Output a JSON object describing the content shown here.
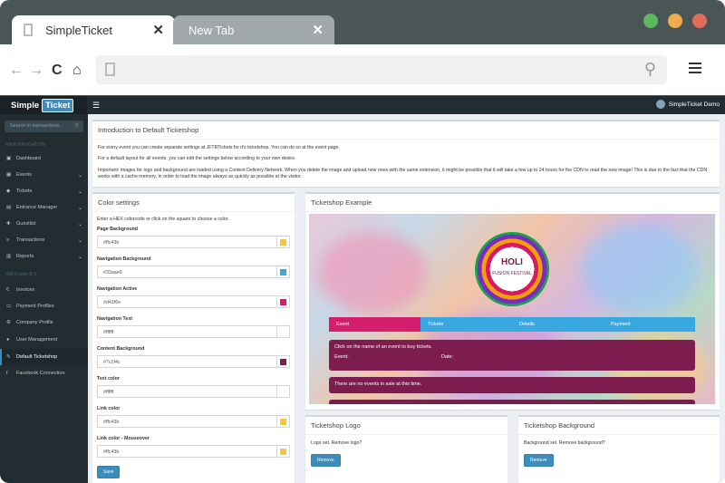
{
  "browser": {
    "tabs": [
      {
        "label": "SimpleTicket"
      },
      {
        "label": "New Tab"
      }
    ],
    "colors": {
      "green": "#5cb85c",
      "yellow": "#f0ad4e",
      "red": "#e06c5c"
    }
  },
  "app": {
    "logo_left": "Simple",
    "logo_right": "Ticket",
    "user": "SimpleTicket Demo",
    "search_placeholder": "Search in transactions..."
  },
  "sidebar": {
    "section_main": "MAIN NAVIGATION",
    "section_org": "Holi Fusion B.V.",
    "main_items": [
      {
        "label": "Dashboard"
      },
      {
        "label": "Events"
      },
      {
        "label": "Tickets"
      },
      {
        "label": "Entrance Manager"
      },
      {
        "label": "Guestlist"
      },
      {
        "label": "Transactions"
      },
      {
        "label": "Reports"
      }
    ],
    "org_items": [
      {
        "label": "Invoices"
      },
      {
        "label": "Payment Profiles"
      },
      {
        "label": "Company Profile"
      },
      {
        "label": "User Management"
      },
      {
        "label": "Default Ticketshop"
      },
      {
        "label": "Facebook Connection"
      }
    ]
  },
  "intro": {
    "title": "Introduction to Default Ticketshop",
    "p1": "For every event you can create separate settings at JFTRTickets for it's ticketshop. You can do so at the event page.",
    "p2": "For a default layout for all events, you can edit the settings below according to your own desire.",
    "p3": "Important: images for logo and background are loaded using a Content Delivery Network. When you delete the image and upload new ones with the same extension, it might be possible that it will take a few up to 24 hours for the CDN to read the new image! This is due to the fact that the CDN works with a cache memory, in order to load the image always as quickly as possible at the visitor."
  },
  "colors_box": {
    "title": "Color settings",
    "hint": "Enter a HEX colorcode or click on the square to choose a color.",
    "fields": [
      {
        "label": "Page Background",
        "value": "#ffc43b",
        "swatch": "#ffc43b"
      },
      {
        "label": "Navigation Background",
        "value": "#33aae0",
        "swatch": "#33aae0"
      },
      {
        "label": "Navigation Active",
        "value": "#d41f6e",
        "swatch": "#d41f6e"
      },
      {
        "label": "Navigation Text",
        "value": "#ffffff",
        "swatch": "#ffffff"
      },
      {
        "label": "Content Background",
        "value": "#7c1f4c",
        "swatch": "#7c1f4c"
      },
      {
        "label": "Text color",
        "value": "#ffffff",
        "swatch": "#ffffff"
      },
      {
        "label": "Link color",
        "value": "#ffc43b",
        "swatch": "#ffc43b"
      },
      {
        "label": "Link color - Mouseover",
        "value": "#ffc43b",
        "swatch": "#ffc43b"
      }
    ],
    "save": "Save"
  },
  "example": {
    "title": "Ticketshop Example",
    "holi": "HOLI",
    "fusion": "FUSION",
    "festival": "FESTIVAL",
    "tabs": [
      {
        "label": "Event"
      },
      {
        "label": "Tickets"
      },
      {
        "label": "Details"
      },
      {
        "label": "Payment"
      }
    ],
    "click_text": "Click on the name of an event to buy tickets.",
    "event_label": "Event:",
    "date_label": "Date:",
    "no_events": "There are no events in sale at this time."
  },
  "logo_box": {
    "title": "Ticketshop Logo",
    "text": "Logo set. Remove logo?",
    "remove": "Remove"
  },
  "bg_box": {
    "title": "Ticketshop Background",
    "text": "Background set. Remove background?",
    "remove": "Remove"
  }
}
